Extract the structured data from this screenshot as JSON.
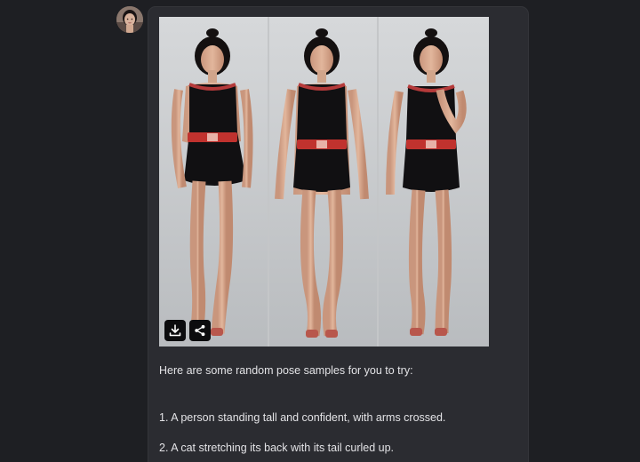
{
  "message": {
    "intro": "Here are some random pose samples for you to try:",
    "items": [
      "1. A person standing tall and confident, with arms crossed.",
      "2. A cat stretching its back with its tail curled up."
    ]
  },
  "icons": {
    "download": "download-icon",
    "share": "share-icon"
  },
  "colors": {
    "page_bg": "#1e1f23",
    "bubble_bg": "#2b2c31",
    "text": "#e3e3e6",
    "button_bg": "#0c0c0e"
  }
}
